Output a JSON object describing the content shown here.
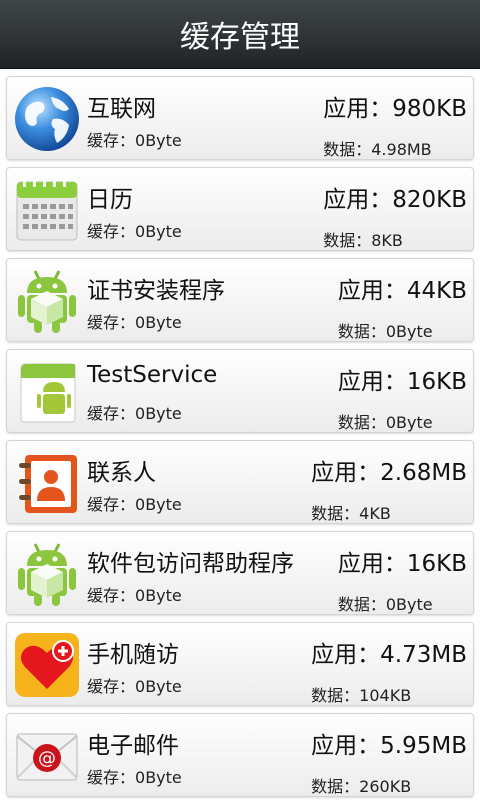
{
  "header": {
    "title": "缓存管理"
  },
  "labels": {
    "cache": "缓存：",
    "app": "应用：",
    "data": "数据："
  },
  "apps": [
    {
      "name": "互联网",
      "icon": "globe-icon",
      "cache": "0Byte",
      "app_size": "980KB",
      "data_size": "4.98MB"
    },
    {
      "name": "日历",
      "icon": "calendar-icon",
      "cache": "0Byte",
      "app_size": "820KB",
      "data_size": "8KB"
    },
    {
      "name": "证书安装程序",
      "icon": "android-package-icon",
      "cache": "0Byte",
      "app_size": "44KB",
      "data_size": "0Byte"
    },
    {
      "name": "TestService",
      "icon": "android-default-icon",
      "cache": "0Byte",
      "app_size": "16KB",
      "data_size": "0Byte"
    },
    {
      "name": "联系人",
      "icon": "contacts-icon",
      "cache": "0Byte",
      "app_size": "2.68MB",
      "data_size": "4KB"
    },
    {
      "name": "软件包访问帮助程序",
      "icon": "android-package-icon",
      "cache": "0Byte",
      "app_size": "16KB",
      "data_size": "0Byte"
    },
    {
      "name": "手机随访",
      "icon": "heart-plus-icon",
      "cache": "0Byte",
      "app_size": "4.73MB",
      "data_size": "104KB"
    },
    {
      "name": "电子邮件",
      "icon": "email-icon",
      "cache": "0Byte",
      "app_size": "5.95MB",
      "data_size": "260KB"
    }
  ]
}
